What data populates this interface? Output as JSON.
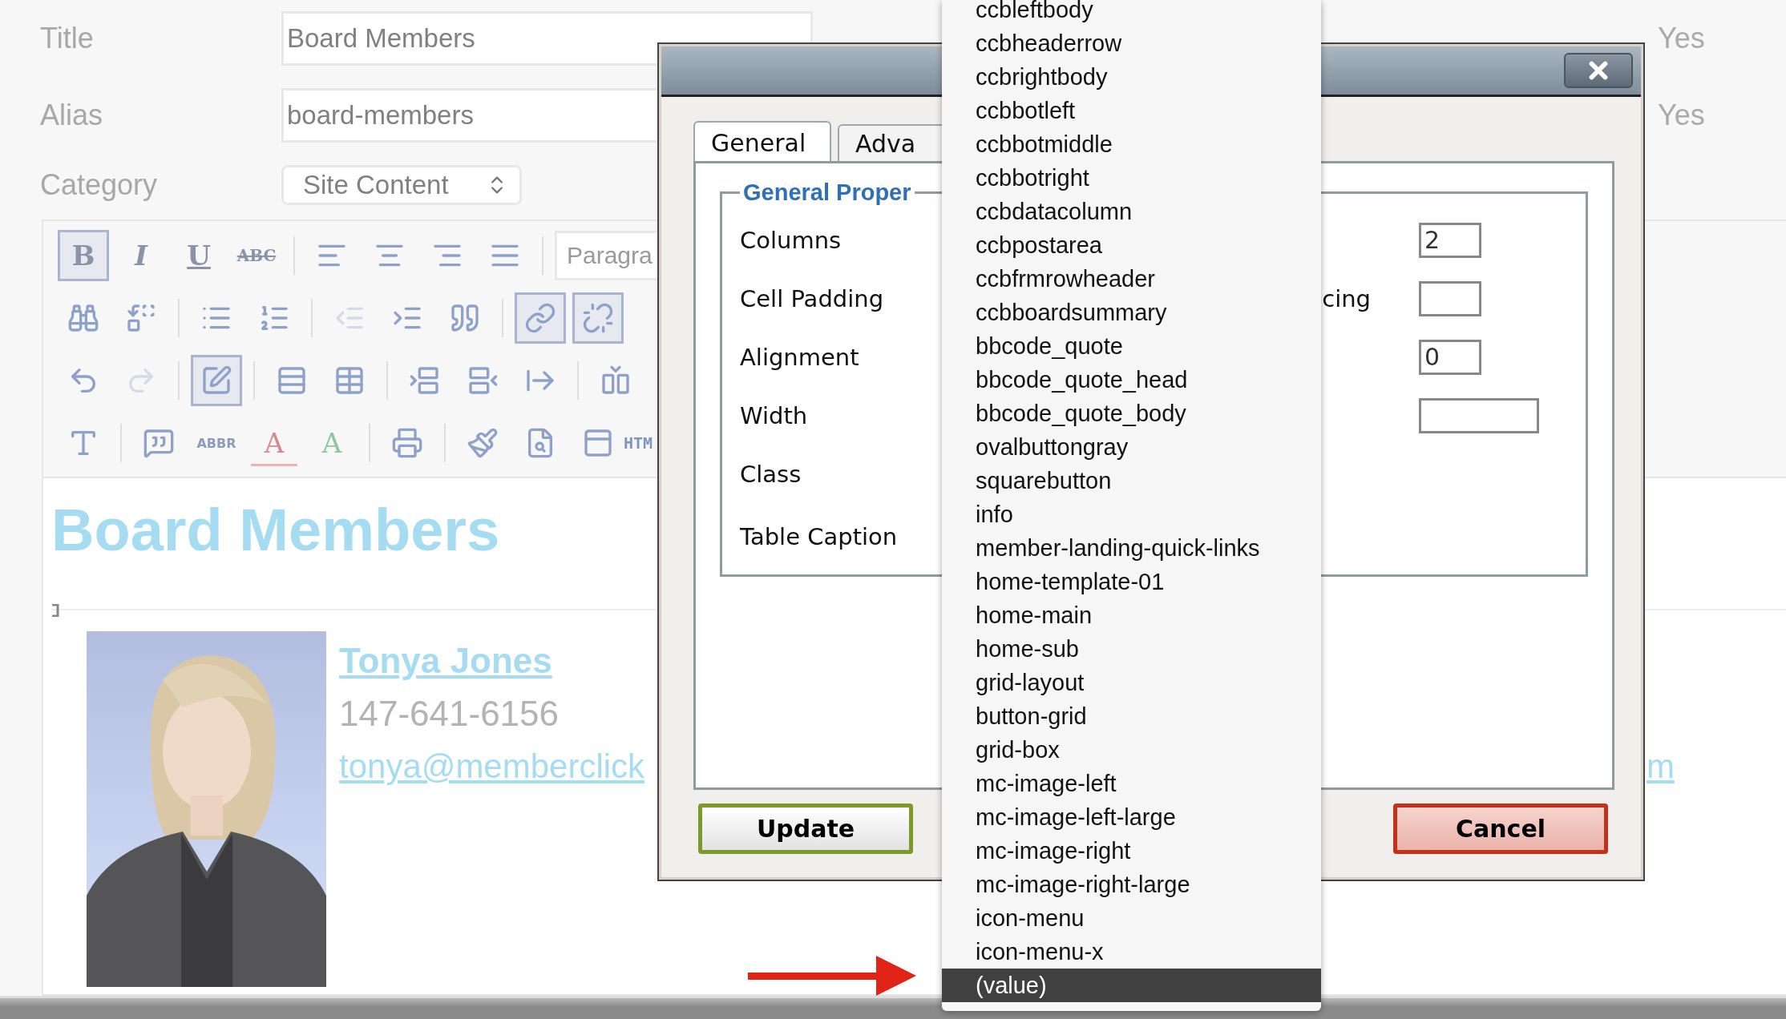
{
  "form": {
    "fields": [
      {
        "label": "Title",
        "value": "Board Members",
        "kind": "text"
      },
      {
        "label": "Alias",
        "value": "board-members",
        "kind": "text"
      },
      {
        "label": "Category",
        "value": "Site Content",
        "kind": "select"
      }
    ],
    "right_labels": [
      "Yes",
      "Yes"
    ]
  },
  "toolbar": {
    "rows": [
      {
        "groups": [
          [
            {
              "kind": "bold",
              "label": "B",
              "selected": true
            },
            {
              "kind": "italic",
              "label": "I",
              "selected": false
            },
            {
              "kind": "underline",
              "label": "U",
              "selected": false
            },
            {
              "kind": "strike",
              "label": "ABC",
              "selected": false
            }
          ],
          [
            {
              "kind": "alignleft",
              "selected": false
            },
            {
              "kind": "aligncenter",
              "selected": false
            },
            {
              "kind": "alignright",
              "selected": false
            },
            {
              "kind": "justify",
              "selected": false
            }
          ],
          [
            {
              "kind": "select",
              "label": "Paragra"
            }
          ]
        ]
      },
      {
        "groups": [
          [
            {
              "kind": "find",
              "selected": false
            },
            {
              "kind": "replace",
              "selected": false
            }
          ],
          [
            {
              "kind": "bullets",
              "selected": false
            },
            {
              "kind": "numbers",
              "selected": false
            }
          ],
          [
            {
              "kind": "outdent",
              "selected": false
            },
            {
              "kind": "indent",
              "selected": false
            },
            {
              "kind": "quote",
              "selected": false
            }
          ],
          [
            {
              "kind": "link",
              "selected": true
            },
            {
              "kind": "unlink",
              "selected": true
            }
          ]
        ]
      },
      {
        "groups": [
          [
            {
              "kind": "undo",
              "selected": false
            },
            {
              "kind": "redo",
              "selected": false
            }
          ],
          [
            {
              "kind": "tableedit",
              "selected": true
            }
          ],
          [
            {
              "kind": "rowprops",
              "selected": false
            },
            {
              "kind": "cellprops",
              "selected": false
            }
          ],
          [
            {
              "kind": "rowbefore",
              "selected": false
            },
            {
              "kind": "rowafter",
              "selected": false
            },
            {
              "kind": "deleterow",
              "selected": false
            }
          ],
          [
            {
              "kind": "colbefore",
              "selected": false
            }
          ]
        ]
      },
      {
        "groups": [
          [
            {
              "kind": "styles",
              "selected": false
            }
          ],
          [
            {
              "kind": "cite",
              "selected": false
            },
            {
              "kind": "abbr",
              "label": "ABBR",
              "selected": false
            },
            {
              "kind": "deleted",
              "label": "A",
              "selected": false
            },
            {
              "kind": "inserted",
              "label": "A",
              "selected": false
            }
          ],
          [
            {
              "kind": "print",
              "selected": false
            }
          ],
          [
            {
              "kind": "cleanup",
              "selected": false
            },
            {
              "kind": "preview",
              "selected": false
            },
            {
              "kind": "layer",
              "selected": false
            },
            {
              "kind": "html",
              "label": "HTM"
            }
          ]
        ]
      }
    ]
  },
  "content": {
    "heading": "Board Members",
    "members": [
      {
        "kind": "picture",
        "name": "Tonya Jones",
        "phone": "147-641-6156",
        "email": "tonya@memberclick"
      }
    ],
    "second_email": "m"
  },
  "dialog": {
    "tabs": [
      {
        "label": "General",
        "selected": true
      },
      {
        "label": "Adva",
        "selected": false
      }
    ],
    "legend": "General Proper",
    "rows": [
      {
        "label": "Columns",
        "kind": "short",
        "value": "2"
      },
      {
        "label": "Cell Padding",
        "right_label": "cing",
        "kind": "short"
      },
      {
        "label": "Alignment",
        "kind": "short",
        "value": "0"
      },
      {
        "label": "Width",
        "kind": "wide"
      },
      {
        "label": "Class",
        "kind": "none"
      },
      {
        "label": "Table Caption",
        "kind": "none"
      }
    ],
    "buttons": [
      {
        "label": "Update",
        "kind": "confirm"
      },
      {
        "label": "Cancel",
        "kind": "cancel"
      }
    ]
  },
  "dropdown": {
    "items": [
      {
        "label": "ccbleftbody",
        "selected": false
      },
      {
        "label": "ccbheaderrow",
        "selected": false
      },
      {
        "label": "ccbrightbody",
        "selected": false
      },
      {
        "label": "ccbbotleft",
        "selected": false
      },
      {
        "label": "ccbbotmiddle",
        "selected": false
      },
      {
        "label": "ccbbotright",
        "selected": false
      },
      {
        "label": "ccbdatacolumn",
        "selected": false
      },
      {
        "label": "ccbpostarea",
        "selected": false
      },
      {
        "label": "ccbfrmrowheader",
        "selected": false
      },
      {
        "label": "ccbboardsummary",
        "selected": false
      },
      {
        "label": "bbcode_quote",
        "selected": false
      },
      {
        "label": "bbcode_quote_head",
        "selected": false
      },
      {
        "label": "bbcode_quote_body",
        "selected": false
      },
      {
        "label": "ovalbuttongray",
        "selected": false
      },
      {
        "label": "squarebutton",
        "selected": false
      },
      {
        "label": "info",
        "selected": false
      },
      {
        "label": "member-landing-quick-links",
        "selected": false
      },
      {
        "label": "home-template-01",
        "selected": false
      },
      {
        "label": "home-main",
        "selected": false
      },
      {
        "label": "home-sub",
        "selected": false
      },
      {
        "label": "grid-layout",
        "selected": false
      },
      {
        "label": "button-grid",
        "selected": false
      },
      {
        "label": "grid-box",
        "selected": false
      },
      {
        "label": "mc-image-left",
        "selected": false
      },
      {
        "label": "mc-image-left-large",
        "selected": false
      },
      {
        "label": "mc-image-right",
        "selected": false
      },
      {
        "label": "mc-image-right-large",
        "selected": false
      },
      {
        "label": "icon-menu",
        "selected": false
      },
      {
        "label": "icon-menu-x",
        "selected": false
      },
      {
        "label": "(value)",
        "selected": true
      }
    ]
  }
}
